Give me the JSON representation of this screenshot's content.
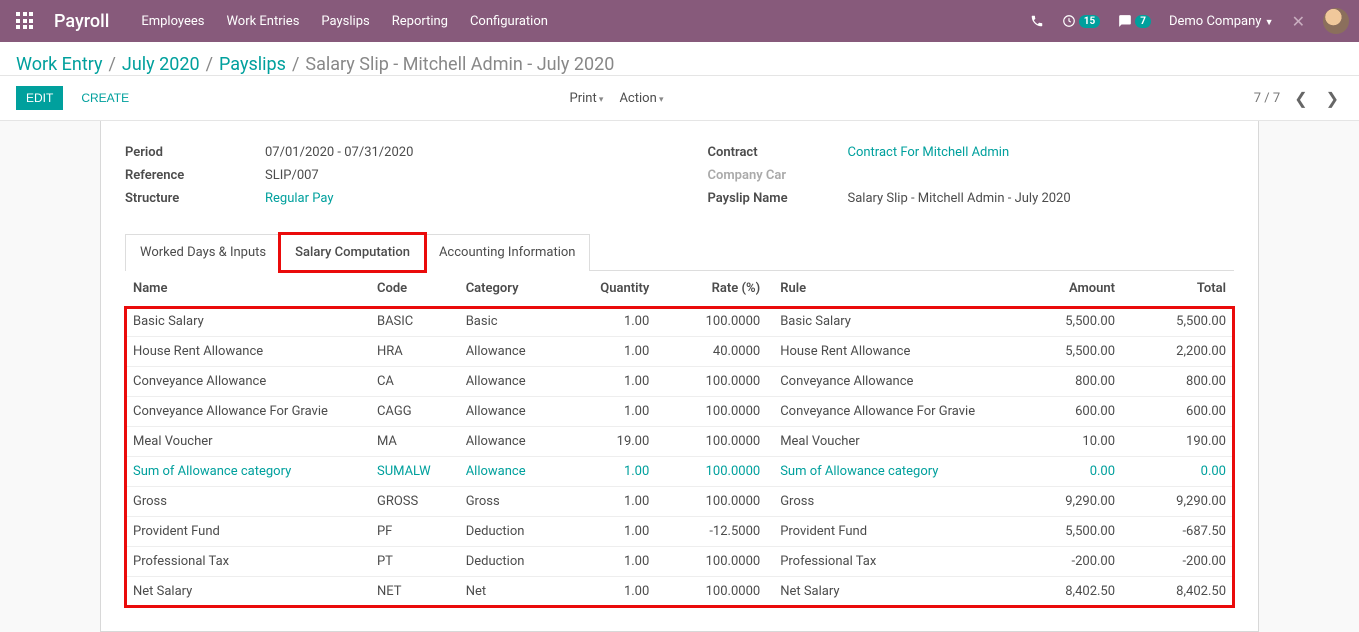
{
  "header": {
    "brand": "Payroll",
    "menu": [
      "Employees",
      "Work Entries",
      "Payslips",
      "Reporting",
      "Configuration"
    ],
    "badge_activities": "15",
    "badge_messages": "7",
    "company": "Demo Company"
  },
  "breadcrumb": {
    "items": [
      "Work Entry",
      "July 2020",
      "Payslips"
    ],
    "current": "Salary Slip - Mitchell Admin - July 2020"
  },
  "actions": {
    "edit": "EDIT",
    "create": "CREATE",
    "print": "Print",
    "action": "Action"
  },
  "pager": {
    "text": "7 / 7"
  },
  "form": {
    "left": {
      "period_label": "Period",
      "period_value": "07/01/2020 - 07/31/2020",
      "reference_label": "Reference",
      "reference_value": "SLIP/007",
      "structure_label": "Structure",
      "structure_value": "Regular Pay"
    },
    "right": {
      "contract_label": "Contract",
      "contract_value": "Contract For Mitchell Admin",
      "company_car_label": "Company Car",
      "company_car_value": "",
      "payslip_name_label": "Payslip Name",
      "payslip_name_value": "Salary Slip - Mitchell Admin - July 2020"
    }
  },
  "tabs": [
    "Worked Days & Inputs",
    "Salary Computation",
    "Accounting Information"
  ],
  "table": {
    "headers": {
      "name": "Name",
      "code": "Code",
      "category": "Category",
      "quantity": "Quantity",
      "rate": "Rate (%)",
      "rule": "Rule",
      "amount": "Amount",
      "total": "Total"
    },
    "rows": [
      {
        "name": "Basic Salary",
        "code": "BASIC",
        "category": "Basic",
        "quantity": "1.00",
        "rate": "100.0000",
        "rule": "Basic Salary",
        "amount": "5,500.00",
        "total": "5,500.00",
        "link": false
      },
      {
        "name": "House Rent Allowance",
        "code": "HRA",
        "category": "Allowance",
        "quantity": "1.00",
        "rate": "40.0000",
        "rule": "House Rent Allowance",
        "amount": "5,500.00",
        "total": "2,200.00",
        "link": false
      },
      {
        "name": "Conveyance Allowance",
        "code": "CA",
        "category": "Allowance",
        "quantity": "1.00",
        "rate": "100.0000",
        "rule": "Conveyance Allowance",
        "amount": "800.00",
        "total": "800.00",
        "link": false
      },
      {
        "name": "Conveyance Allowance For Gravie",
        "code": "CAGG",
        "category": "Allowance",
        "quantity": "1.00",
        "rate": "100.0000",
        "rule": "Conveyance Allowance For Gravie",
        "amount": "600.00",
        "total": "600.00",
        "link": false
      },
      {
        "name": "Meal Voucher",
        "code": "MA",
        "category": "Allowance",
        "quantity": "19.00",
        "rate": "100.0000",
        "rule": "Meal Voucher",
        "amount": "10.00",
        "total": "190.00",
        "link": false
      },
      {
        "name": "Sum of Allowance category",
        "code": "SUMALW",
        "category": "Allowance",
        "quantity": "1.00",
        "rate": "100.0000",
        "rule": "Sum of Allowance category",
        "amount": "0.00",
        "total": "0.00",
        "link": true
      },
      {
        "name": "Gross",
        "code": "GROSS",
        "category": "Gross",
        "quantity": "1.00",
        "rate": "100.0000",
        "rule": "Gross",
        "amount": "9,290.00",
        "total": "9,290.00",
        "link": false
      },
      {
        "name": "Provident Fund",
        "code": "PF",
        "category": "Deduction",
        "quantity": "1.00",
        "rate": "-12.5000",
        "rule": "Provident Fund",
        "amount": "5,500.00",
        "total": "-687.50",
        "link": false
      },
      {
        "name": "Professional Tax",
        "code": "PT",
        "category": "Deduction",
        "quantity": "1.00",
        "rate": "100.0000",
        "rule": "Professional Tax",
        "amount": "-200.00",
        "total": "-200.00",
        "link": false
      },
      {
        "name": "Net Salary",
        "code": "NET",
        "category": "Net",
        "quantity": "1.00",
        "rate": "100.0000",
        "rule": "Net Salary",
        "amount": "8,402.50",
        "total": "8,402.50",
        "link": false
      }
    ]
  }
}
